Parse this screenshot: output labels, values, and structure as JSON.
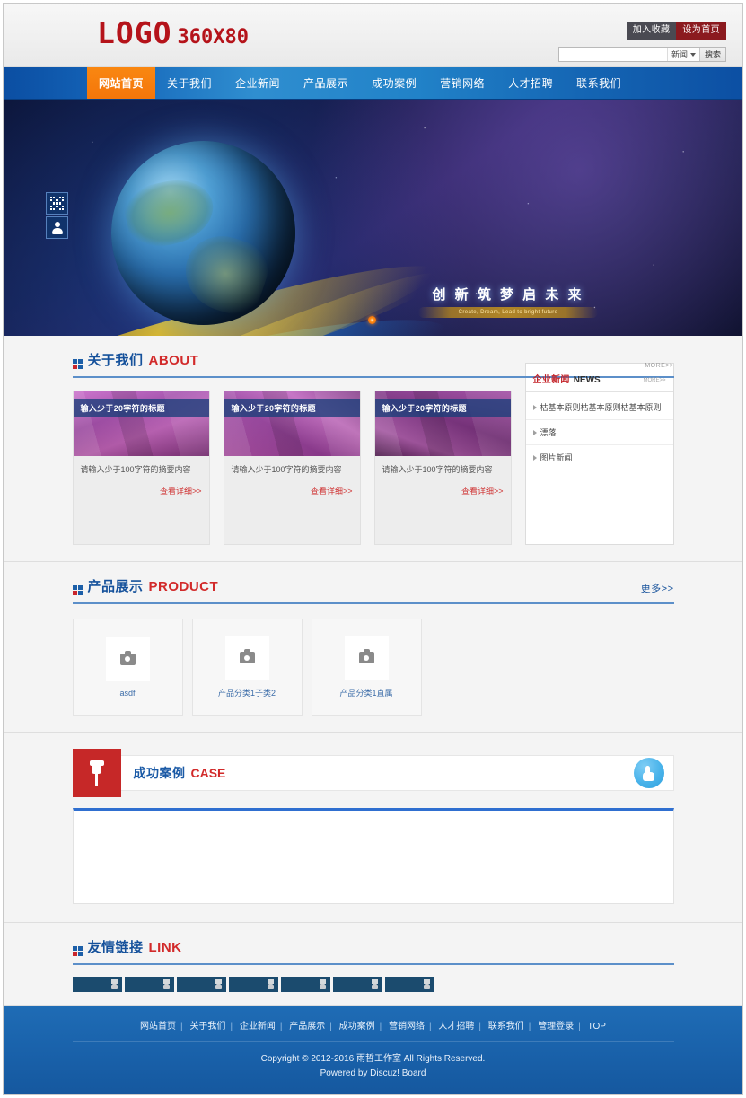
{
  "header": {
    "logo_main": "LOGO",
    "logo_sub": "360X80",
    "favorite_label": "加入收藏",
    "sethome_label": "设为首页",
    "search": {
      "value": "",
      "placeholder": "",
      "category": "新闻",
      "button": "搜索"
    }
  },
  "nav": {
    "items": [
      {
        "label": "网站首页",
        "active": true
      },
      {
        "label": "关于我们",
        "active": false
      },
      {
        "label": "企业新闻",
        "active": false
      },
      {
        "label": "产品展示",
        "active": false
      },
      {
        "label": "成功案例",
        "active": false
      },
      {
        "label": "营销网络",
        "active": false
      },
      {
        "label": "人才招聘",
        "active": false
      },
      {
        "label": "联系我们",
        "active": false
      }
    ]
  },
  "hero": {
    "title": "创 新  筑 梦  启 未 来",
    "subtitle": "Create, Dream, Lead to bright future",
    "side_tools": [
      {
        "name": "qrcode-icon"
      },
      {
        "name": "user-icon"
      }
    ]
  },
  "about": {
    "title_cn": "关于我们",
    "title_en": "ABOUT",
    "more": "MORE>>",
    "cards": [
      {
        "title": "输入少于20字符的标题",
        "desc": "请输入少于100字符的摘要内容",
        "more": "查看详细>>"
      },
      {
        "title": "输入少于20字符的标题",
        "desc": "请输入少于100字符的摘要内容",
        "more": "查看详细>>"
      },
      {
        "title": "输入少于20字符的标题",
        "desc": "请输入少于100字符的摘要内容",
        "more": "查看详细>>"
      }
    ]
  },
  "news": {
    "title_cn": "企业新闻",
    "title_en": "NEWS",
    "more": "MORE>>",
    "items": [
      {
        "label": "枯基本原则枯基本原则枯基本原则"
      },
      {
        "label": "漂落"
      },
      {
        "label": "图片新闻"
      }
    ]
  },
  "products": {
    "title_cn": "产品展示",
    "title_en": "PRODUCT",
    "more": "更多>>",
    "items": [
      {
        "name": "asdf"
      },
      {
        "name": "产品分类1子类2"
      },
      {
        "name": "产品分类1直属"
      }
    ]
  },
  "cases": {
    "title_cn": "成功案例",
    "title_en": "CASE"
  },
  "links": {
    "title_cn": "友情链接",
    "title_en": "LINK",
    "chips": [
      1,
      2,
      3,
      4,
      5,
      6,
      7
    ]
  },
  "footer": {
    "nav": [
      "网站首页",
      "关于我们",
      "企业新闻",
      "产品展示",
      "成功案例",
      "营销网络",
      "人才招聘",
      "联系我们",
      "管理登录",
      "TOP"
    ],
    "copyright": "Copyright © 2012-2016 雨哲工作室 All Rights Reserved.",
    "powered": "Powered by Discuz! Board"
  },
  "colors": {
    "brand_blue": "#15519b",
    "brand_red": "#d22a2a",
    "accent_orange": "#f4760a",
    "nav_blue": "#1464b8",
    "footer_blue": "#1a63ac"
  }
}
